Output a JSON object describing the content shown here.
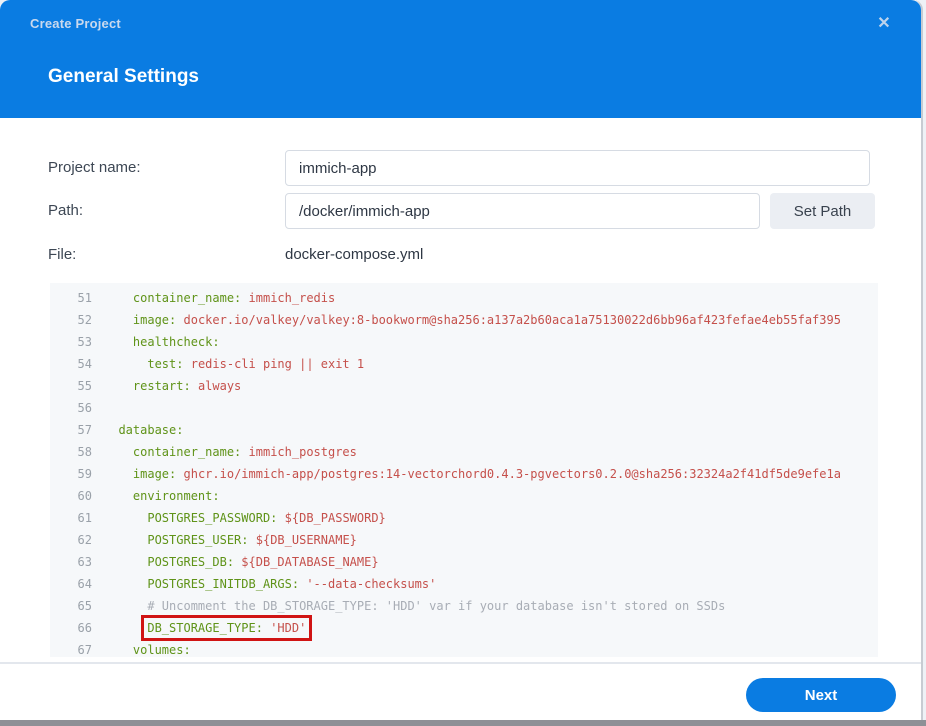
{
  "window": {
    "title": "Create Project",
    "close_icon": "✕"
  },
  "header": {
    "section_title": "General Settings"
  },
  "form": {
    "project_name": {
      "label": "Project name:",
      "value": "immich-app"
    },
    "path": {
      "label": "Path:",
      "value": "/docker/immich-app",
      "button_label": "Set Path"
    },
    "file": {
      "label": "File:",
      "value": "docker-compose.yml"
    }
  },
  "editor": {
    "language": "yaml",
    "lines": [
      {
        "num": 51,
        "indent": 4,
        "key": "container_name:",
        "value": "immich_redis"
      },
      {
        "num": 52,
        "indent": 4,
        "key": "image:",
        "value": "docker.io/valkey/valkey:8-bookworm@sha256:a137a2b60aca1a75130022d6bb96af423fefae4eb55faf395"
      },
      {
        "num": 53,
        "indent": 4,
        "key": "healthcheck:"
      },
      {
        "num": 54,
        "indent": 6,
        "key": "test:",
        "value": "redis-cli ping || exit 1"
      },
      {
        "num": 55,
        "indent": 4,
        "key": "restart:",
        "value": "always"
      },
      {
        "num": 56,
        "indent": 0
      },
      {
        "num": 57,
        "indent": 2,
        "key": "database:"
      },
      {
        "num": 58,
        "indent": 4,
        "key": "container_name:",
        "value": "immich_postgres"
      },
      {
        "num": 59,
        "indent": 4,
        "key": "image:",
        "value": "ghcr.io/immich-app/postgres:14-vectorchord0.4.3-pgvectors0.2.0@sha256:32324a2f41df5de9efe1a"
      },
      {
        "num": 60,
        "indent": 4,
        "key": "environment:"
      },
      {
        "num": 61,
        "indent": 6,
        "key": "POSTGRES_PASSWORD:",
        "value": "${DB_PASSWORD}"
      },
      {
        "num": 62,
        "indent": 6,
        "key": "POSTGRES_USER:",
        "value": "${DB_USERNAME}"
      },
      {
        "num": 63,
        "indent": 6,
        "key": "POSTGRES_DB:",
        "value": "${DB_DATABASE_NAME}"
      },
      {
        "num": 64,
        "indent": 6,
        "key": "POSTGRES_INITDB_ARGS:",
        "value": "'--data-checksums'"
      },
      {
        "num": 65,
        "indent": 6,
        "comment": "# Uncomment the DB_STORAGE_TYPE: 'HDD' var if your database isn't stored on SSDs"
      },
      {
        "num": 66,
        "indent": 6,
        "key": "DB_STORAGE_TYPE:",
        "value": "'HDD'",
        "highlighted": true
      },
      {
        "num": 67,
        "indent": 4,
        "key": "volumes:"
      }
    ]
  },
  "footer": {
    "next_label": "Next"
  },
  "colors": {
    "accent": "#0a7ce2",
    "key_color": "#5f9318",
    "value_color": "#c5504b",
    "comment_color": "#a8adb5",
    "highlight_color": "#d01414",
    "line_number_color": "#9aa1a9",
    "editor_background": "#f6f8fa"
  }
}
